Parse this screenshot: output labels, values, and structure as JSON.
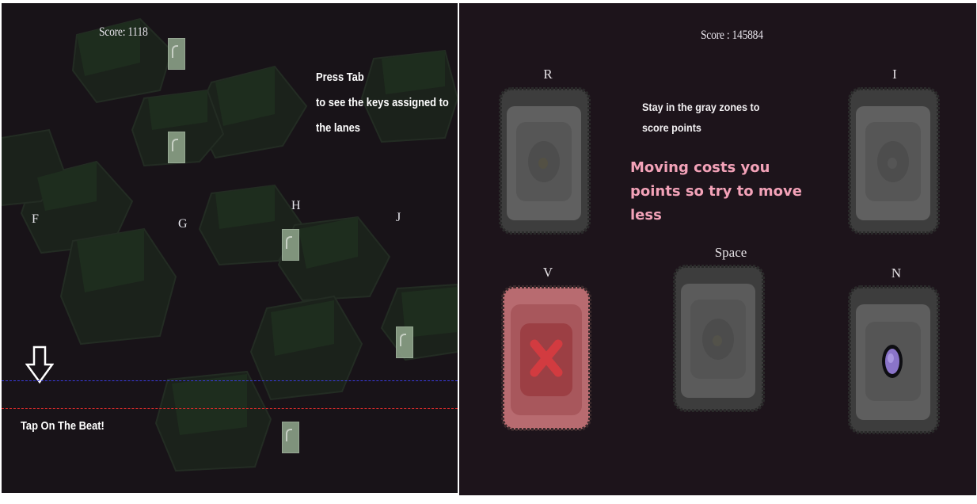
{
  "left_panel": {
    "score": "Score: 1118",
    "hint": {
      "title": "Press Tab",
      "line1": "to see the keys assigned to",
      "line2": "the lanes"
    },
    "lanes": [
      "F",
      "G",
      "H",
      "J"
    ],
    "tap_text": "Tap On The Beat!",
    "icons": [
      "down-arrow-icon",
      "note-block-icon"
    ],
    "colors": {
      "background": "#181318",
      "hex_tile": "#1e2a1e",
      "blue_line": "#3a3adf",
      "red_line": "#d02a2a",
      "note": "#8ea48a"
    }
  },
  "right_panel": {
    "score": "Score : 145884",
    "tiles": [
      {
        "key": "R",
        "state": "gray"
      },
      {
        "key": "I",
        "state": "gray"
      },
      {
        "key": "V",
        "state": "red-cross"
      },
      {
        "key": "Space",
        "state": "gray"
      },
      {
        "key": "N",
        "state": "player"
      }
    ],
    "info": {
      "line1": "Stay in the gray zones to",
      "line2": "score points",
      "warning1": "Moving costs you",
      "warning2": "points so try to move",
      "warning3": "less"
    },
    "icons": [
      "cross-icon",
      "player-orb-icon"
    ],
    "colors": {
      "background": "#1d141b",
      "warning": "#f3a2b8",
      "gray_tile": "#5b5b5b",
      "red_tile": "#b86b70",
      "player": "#8a74c9"
    }
  }
}
